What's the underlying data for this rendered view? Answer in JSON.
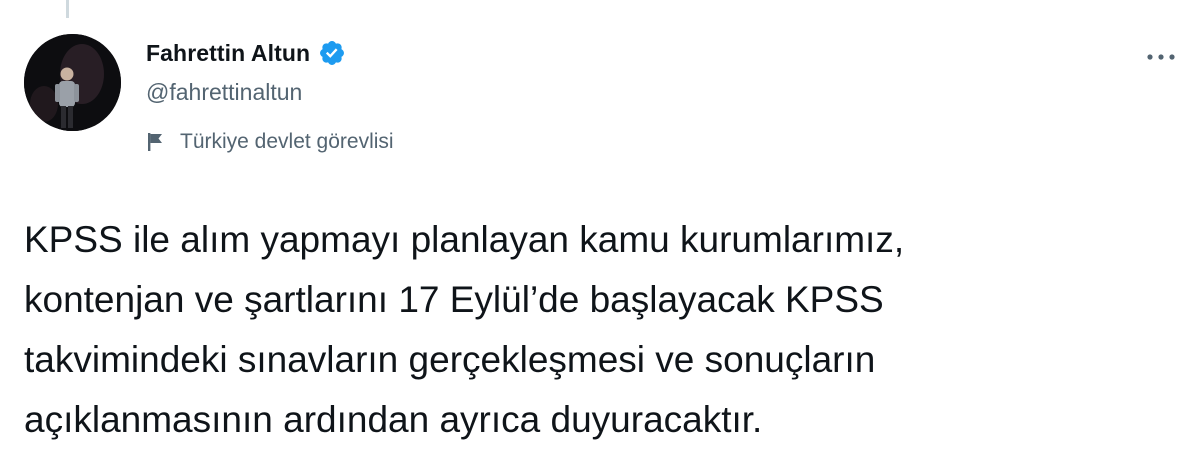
{
  "author": {
    "name": "Fahrettin Altun",
    "handle": "@fahrettinaltun",
    "verified": true,
    "label": "Türkiye devlet görevlisi",
    "label_icon": "flag-icon",
    "verified_icon": "verified-badge-icon"
  },
  "menu": {
    "icon": "more-options-icon"
  },
  "tweet": {
    "lines": [
      "KPSS ile alım yapmayı planlayan kamu kurumlarımız,",
      "kontenjan ve şartlarını 17 Eylül’de başlayacak KPSS",
      "takvimindeki sınavların gerçekleşmesi ve sonuçların",
      "açıklanmasının ardından ayrıca duyuracaktır."
    ]
  },
  "colors": {
    "text_primary": "#0f1419",
    "text_secondary": "#536471",
    "verified_blue": "#1d9bf0",
    "background": "#ffffff"
  }
}
